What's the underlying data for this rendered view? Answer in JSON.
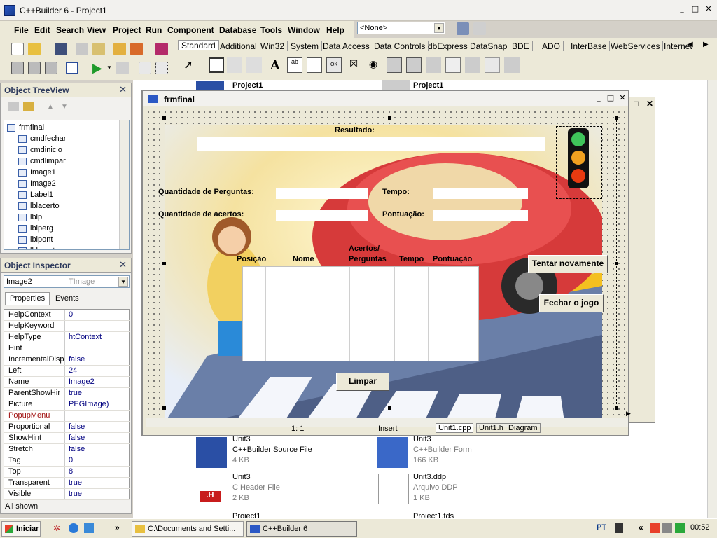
{
  "window": {
    "title": "C++Builder 6 - Project1"
  },
  "menu": [
    "File",
    "Edit",
    "Search",
    "View",
    "Project",
    "Run",
    "Component",
    "Database",
    "Tools",
    "Window",
    "Help"
  ],
  "config_combo": "<None>",
  "palette_tabs": [
    "Standard",
    "Additional",
    "Win32",
    "System",
    "Data Access",
    "Data Controls",
    "dbExpress",
    "DataSnap",
    "BDE",
    "ADO",
    "InterBase",
    "WebServices",
    "Internet"
  ],
  "tree": {
    "title": "Object TreeView",
    "root": "frmfinal",
    "items": [
      "cmdfechar",
      "cmdinicio",
      "cmdlimpar",
      "Image1",
      "Image2",
      "Label1",
      "lblacerto",
      "lblp",
      "lblperg",
      "lblpont",
      "lblacert"
    ]
  },
  "inspector": {
    "title": "Object Inspector",
    "object": "Image2",
    "class": "TImage",
    "tabs": [
      "Properties",
      "Events"
    ],
    "props": [
      [
        "HelpContext",
        "0"
      ],
      [
        "HelpKeyword",
        ""
      ],
      [
        "HelpType",
        "htContext"
      ],
      [
        "Hint",
        ""
      ],
      [
        "IncrementalDisp",
        "false"
      ],
      [
        "Left",
        "24"
      ],
      [
        "Name",
        "Image2"
      ],
      [
        "ParentShowHir",
        "true"
      ],
      [
        "Picture",
        "PEGImage)"
      ],
      [
        "PopupMenu",
        ""
      ],
      [
        "Proportional",
        "false"
      ],
      [
        "ShowHint",
        "false"
      ],
      [
        "Stretch",
        "false"
      ],
      [
        "Tag",
        "0"
      ],
      [
        "Top",
        "8"
      ],
      [
        "Transparent",
        "true"
      ],
      [
        "Visible",
        "true"
      ]
    ],
    "footer": "All shown"
  },
  "background_labels": {
    "project1_a": "Project1",
    "project1_b": "Project1"
  },
  "form": {
    "title": "frmfinal",
    "resultado": "Resultado:",
    "qtd_perguntas": "Quantidade de Perguntas:",
    "qtd_acertos": "Quantidade de acertos:",
    "tempo": "Tempo:",
    "pontuacao": "Pontuação:",
    "columns": [
      "Posição",
      "Nome",
      "Acertos/\nPerguntas",
      "Tempo",
      "Pontuação"
    ],
    "btn_tentar": "Tentar novamente",
    "btn_fechar": "Fechar o jogo",
    "btn_limpar": "Limpar"
  },
  "editor_status": {
    "pos": "1:   1",
    "mode": "Insert",
    "tabs": [
      "Unit1.cpp",
      "Unit1.h",
      "Diagram"
    ]
  },
  "files": [
    {
      "name": "Unit3",
      "type": "C++Builder Source File",
      "size": "4 KB"
    },
    {
      "name": "Unit3",
      "type": "C++Builder Form",
      "size": "166 KB"
    },
    {
      "name": "Unit3",
      "type": "C Header File",
      "size": "2 KB"
    },
    {
      "name": "Unit3.ddp",
      "type": "Arquivo DDP",
      "size": "1 KB"
    },
    {
      "name": "Project1"
    },
    {
      "name": "Project1.tds"
    }
  ],
  "taskbar": {
    "start": "Iniciar",
    "items": [
      "C:\\Documents and Setti...",
      "C++Builder 6"
    ],
    "lang": "PT",
    "clock": "00:52"
  },
  "colors": {
    "accent": "#316ac5",
    "traffic_green": "#3fc45a",
    "traffic_yellow": "#f0a020",
    "traffic_red": "#e83a10"
  }
}
